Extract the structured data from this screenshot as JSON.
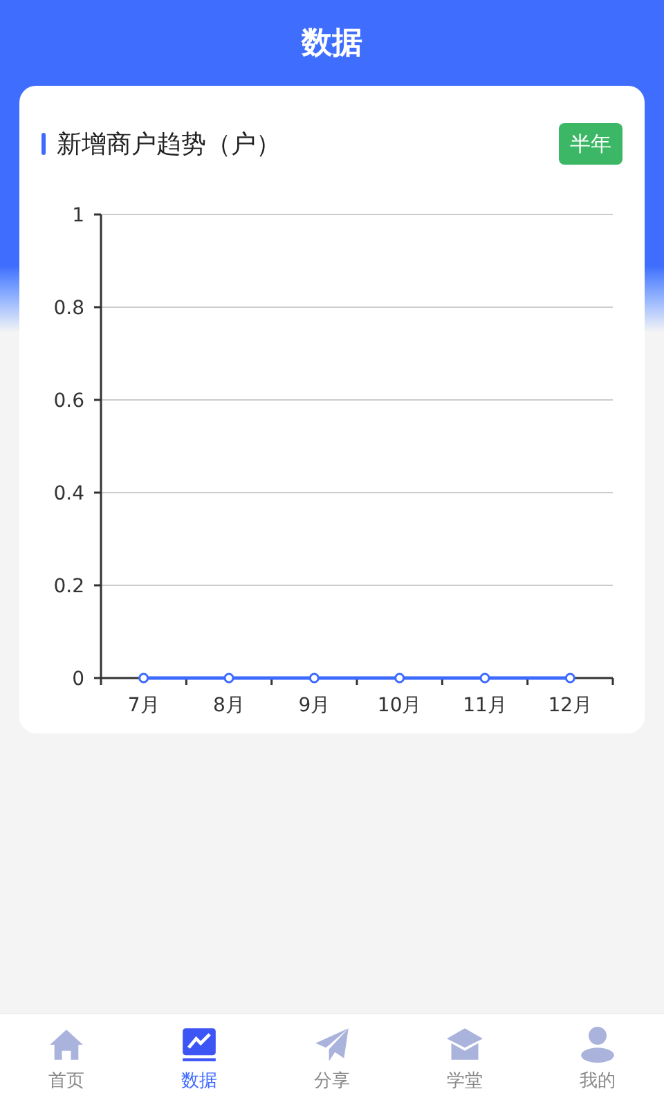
{
  "header": {
    "title": "数据"
  },
  "card": {
    "title": "新增商户趋势（户）",
    "period_button": "半年",
    "chart_data": {
      "type": "line",
      "categories": [
        "7月",
        "8月",
        "9月",
        "10月",
        "11月",
        "12月"
      ],
      "series": [
        {
          "color": "#3d6aff",
          "marker": true,
          "values": [
            0,
            0,
            0,
            0,
            0,
            0
          ]
        }
      ],
      "grid": true,
      "ylim": [
        0,
        1
      ],
      "yticks": [
        0,
        {
          "value": 0.2,
          "label": "0.2"
        },
        {
          "value": 0.4,
          "label": "0.4"
        },
        {
          "value": 0.6,
          "label": "0.6"
        },
        {
          "value": 0.8,
          "label": "0.8"
        },
        1
      ]
    }
  },
  "nav": [
    {
      "kind": "home",
      "label": "首页",
      "selected": false
    },
    {
      "kind": "chart",
      "label": "数据",
      "selected": true
    },
    {
      "kind": "send",
      "label": "分享",
      "selected": false
    },
    {
      "kind": "school",
      "label": "学堂",
      "selected": false
    },
    {
      "kind": "user",
      "label": "我的",
      "selected": false
    }
  ]
}
